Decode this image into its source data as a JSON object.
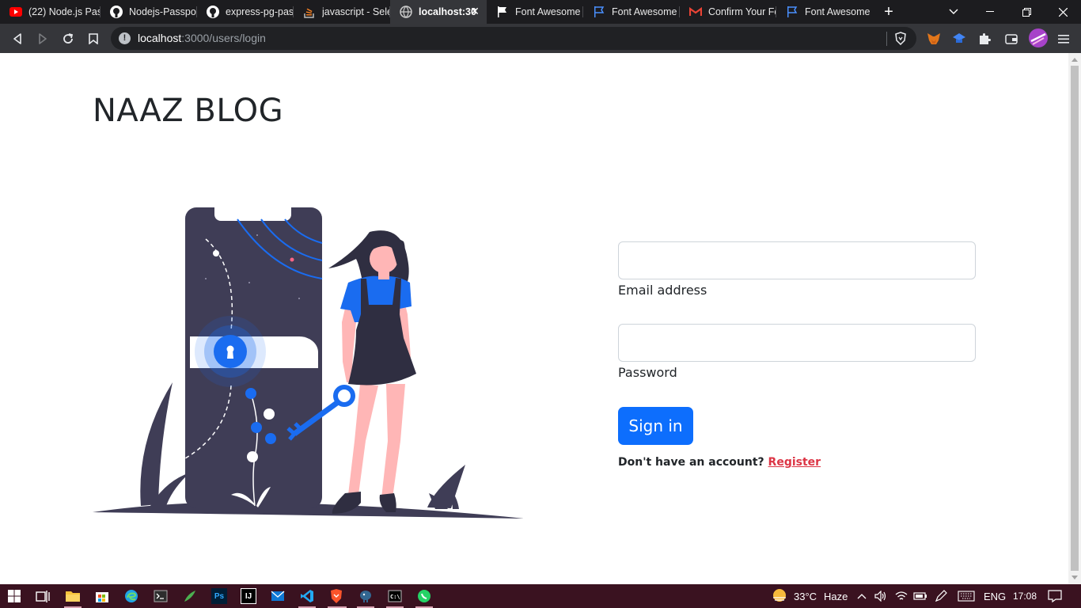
{
  "browser": {
    "tabs": [
      {
        "label": "(22) Node.js Pas",
        "icon": "youtube-icon"
      },
      {
        "label": "Nodejs-Passport",
        "icon": "github-icon"
      },
      {
        "label": "express-pg-pass",
        "icon": "github-icon"
      },
      {
        "label": "javascript - Sele",
        "icon": "stackoverflow-icon"
      },
      {
        "label": "localhost:30",
        "icon": "globe-icon",
        "active": true
      },
      {
        "label": "Font Awesome",
        "icon": "flag-icon"
      },
      {
        "label": "Font Awesome",
        "icon": "flag-outline-icon"
      },
      {
        "label": "Confirm Your Fo",
        "icon": "gmail-icon"
      },
      {
        "label": "Font Awesome",
        "icon": "flag-outline-icon"
      }
    ],
    "url_host": "localhost",
    "url_path": ":3000/users/login"
  },
  "page": {
    "brand": "NAAZ BLOG",
    "email_label": "Email address",
    "email_value": "",
    "password_label": "Password",
    "password_value": "",
    "signin_label": "Sign in",
    "no_account_text": "Don't have an account?",
    "register_link": "Register"
  },
  "colors": {
    "primary": "#0d6efd",
    "link_danger": "#dc3545",
    "illustration_dark": "#3f3d56",
    "illustration_blue": "#1a6cf0",
    "skin": "#ffb6b6"
  },
  "taskbar": {
    "weather_temp": "33°C",
    "weather_text": "Haze",
    "language": "ENG",
    "time": "17:08"
  }
}
